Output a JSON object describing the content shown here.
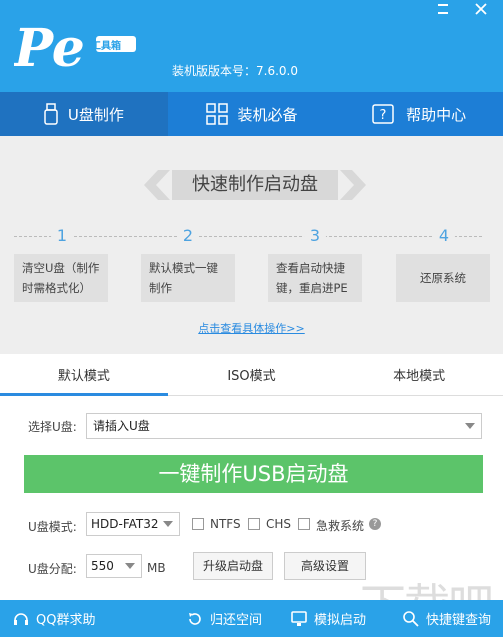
{
  "app": {
    "logo_text": "Pe",
    "logo_badge": "工具箱",
    "version": "装机版版本号：7.6.0.0",
    "min_icon": "minimize-icon",
    "close_icon": "close-icon"
  },
  "tabs": [
    {
      "label": "U盘制作",
      "icon": "usb-icon"
    },
    {
      "label": "装机必备",
      "icon": "grid-icon"
    },
    {
      "label": "帮助中心",
      "icon": "help-book-icon"
    }
  ],
  "main": {
    "banner": "快速制作启动盘",
    "steps": [
      {
        "num": "1",
        "text": "清空U盘（制作时需格式化）"
      },
      {
        "num": "2",
        "text": "默认模式一键制作"
      },
      {
        "num": "3",
        "text": "查看启动快捷键，重启进PE"
      },
      {
        "num": "4",
        "text": "还原系统"
      }
    ],
    "link": "点击查看具体操作>>"
  },
  "modes": [
    "默认模式",
    "ISO模式",
    "本地模式"
  ],
  "form": {
    "select_label": "选择U盘:",
    "select_value": "请插入U盘",
    "make_button": "一键制作USB启动盘",
    "mode_label": "U盘模式:",
    "mode_value": "HDD-FAT32",
    "ntfs": "NTFS",
    "chs": "CHS",
    "rescue": "急救系统",
    "part_label": "U盘分配:",
    "part_value": "550",
    "part_unit": "MB",
    "upgrade_button": "升级启动盘",
    "advanced_button": "高级设置"
  },
  "footer": [
    {
      "label": "QQ群求助",
      "icon": "headset-icon"
    },
    {
      "label": "归还空间",
      "icon": "restore-icon"
    },
    {
      "label": "模拟启动",
      "icon": "monitor-icon"
    },
    {
      "label": "快捷键查询",
      "icon": "search-icon"
    }
  ],
  "watermark": "下载吧"
}
